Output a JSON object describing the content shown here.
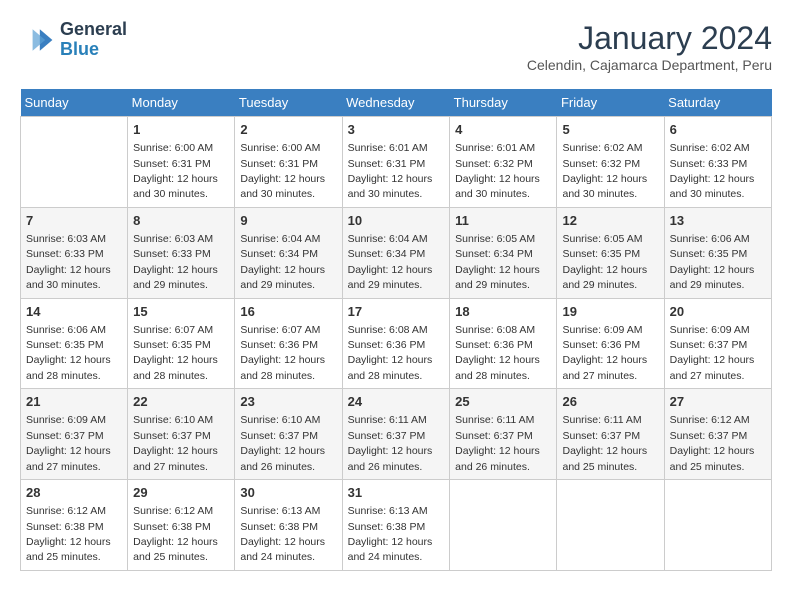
{
  "header": {
    "logo_general": "General",
    "logo_blue": "Blue",
    "month_title": "January 2024",
    "location": "Celendin, Cajamarca Department, Peru"
  },
  "days_of_week": [
    "Sunday",
    "Monday",
    "Tuesday",
    "Wednesday",
    "Thursday",
    "Friday",
    "Saturday"
  ],
  "weeks": [
    [
      {
        "num": "",
        "sunrise": "",
        "sunset": "",
        "daylight": ""
      },
      {
        "num": "1",
        "sunrise": "Sunrise: 6:00 AM",
        "sunset": "Sunset: 6:31 PM",
        "daylight": "Daylight: 12 hours and 30 minutes."
      },
      {
        "num": "2",
        "sunrise": "Sunrise: 6:00 AM",
        "sunset": "Sunset: 6:31 PM",
        "daylight": "Daylight: 12 hours and 30 minutes."
      },
      {
        "num": "3",
        "sunrise": "Sunrise: 6:01 AM",
        "sunset": "Sunset: 6:31 PM",
        "daylight": "Daylight: 12 hours and 30 minutes."
      },
      {
        "num": "4",
        "sunrise": "Sunrise: 6:01 AM",
        "sunset": "Sunset: 6:32 PM",
        "daylight": "Daylight: 12 hours and 30 minutes."
      },
      {
        "num": "5",
        "sunrise": "Sunrise: 6:02 AM",
        "sunset": "Sunset: 6:32 PM",
        "daylight": "Daylight: 12 hours and 30 minutes."
      },
      {
        "num": "6",
        "sunrise": "Sunrise: 6:02 AM",
        "sunset": "Sunset: 6:33 PM",
        "daylight": "Daylight: 12 hours and 30 minutes."
      }
    ],
    [
      {
        "num": "7",
        "sunrise": "Sunrise: 6:03 AM",
        "sunset": "Sunset: 6:33 PM",
        "daylight": "Daylight: 12 hours and 30 minutes."
      },
      {
        "num": "8",
        "sunrise": "Sunrise: 6:03 AM",
        "sunset": "Sunset: 6:33 PM",
        "daylight": "Daylight: 12 hours and 29 minutes."
      },
      {
        "num": "9",
        "sunrise": "Sunrise: 6:04 AM",
        "sunset": "Sunset: 6:34 PM",
        "daylight": "Daylight: 12 hours and 29 minutes."
      },
      {
        "num": "10",
        "sunrise": "Sunrise: 6:04 AM",
        "sunset": "Sunset: 6:34 PM",
        "daylight": "Daylight: 12 hours and 29 minutes."
      },
      {
        "num": "11",
        "sunrise": "Sunrise: 6:05 AM",
        "sunset": "Sunset: 6:34 PM",
        "daylight": "Daylight: 12 hours and 29 minutes."
      },
      {
        "num": "12",
        "sunrise": "Sunrise: 6:05 AM",
        "sunset": "Sunset: 6:35 PM",
        "daylight": "Daylight: 12 hours and 29 minutes."
      },
      {
        "num": "13",
        "sunrise": "Sunrise: 6:06 AM",
        "sunset": "Sunset: 6:35 PM",
        "daylight": "Daylight: 12 hours and 29 minutes."
      }
    ],
    [
      {
        "num": "14",
        "sunrise": "Sunrise: 6:06 AM",
        "sunset": "Sunset: 6:35 PM",
        "daylight": "Daylight: 12 hours and 28 minutes."
      },
      {
        "num": "15",
        "sunrise": "Sunrise: 6:07 AM",
        "sunset": "Sunset: 6:35 PM",
        "daylight": "Daylight: 12 hours and 28 minutes."
      },
      {
        "num": "16",
        "sunrise": "Sunrise: 6:07 AM",
        "sunset": "Sunset: 6:36 PM",
        "daylight": "Daylight: 12 hours and 28 minutes."
      },
      {
        "num": "17",
        "sunrise": "Sunrise: 6:08 AM",
        "sunset": "Sunset: 6:36 PM",
        "daylight": "Daylight: 12 hours and 28 minutes."
      },
      {
        "num": "18",
        "sunrise": "Sunrise: 6:08 AM",
        "sunset": "Sunset: 6:36 PM",
        "daylight": "Daylight: 12 hours and 28 minutes."
      },
      {
        "num": "19",
        "sunrise": "Sunrise: 6:09 AM",
        "sunset": "Sunset: 6:36 PM",
        "daylight": "Daylight: 12 hours and 27 minutes."
      },
      {
        "num": "20",
        "sunrise": "Sunrise: 6:09 AM",
        "sunset": "Sunset: 6:37 PM",
        "daylight": "Daylight: 12 hours and 27 minutes."
      }
    ],
    [
      {
        "num": "21",
        "sunrise": "Sunrise: 6:09 AM",
        "sunset": "Sunset: 6:37 PM",
        "daylight": "Daylight: 12 hours and 27 minutes."
      },
      {
        "num": "22",
        "sunrise": "Sunrise: 6:10 AM",
        "sunset": "Sunset: 6:37 PM",
        "daylight": "Daylight: 12 hours and 27 minutes."
      },
      {
        "num": "23",
        "sunrise": "Sunrise: 6:10 AM",
        "sunset": "Sunset: 6:37 PM",
        "daylight": "Daylight: 12 hours and 26 minutes."
      },
      {
        "num": "24",
        "sunrise": "Sunrise: 6:11 AM",
        "sunset": "Sunset: 6:37 PM",
        "daylight": "Daylight: 12 hours and 26 minutes."
      },
      {
        "num": "25",
        "sunrise": "Sunrise: 6:11 AM",
        "sunset": "Sunset: 6:37 PM",
        "daylight": "Daylight: 12 hours and 26 minutes."
      },
      {
        "num": "26",
        "sunrise": "Sunrise: 6:11 AM",
        "sunset": "Sunset: 6:37 PM",
        "daylight": "Daylight: 12 hours and 25 minutes."
      },
      {
        "num": "27",
        "sunrise": "Sunrise: 6:12 AM",
        "sunset": "Sunset: 6:37 PM",
        "daylight": "Daylight: 12 hours and 25 minutes."
      }
    ],
    [
      {
        "num": "28",
        "sunrise": "Sunrise: 6:12 AM",
        "sunset": "Sunset: 6:38 PM",
        "daylight": "Daylight: 12 hours and 25 minutes."
      },
      {
        "num": "29",
        "sunrise": "Sunrise: 6:12 AM",
        "sunset": "Sunset: 6:38 PM",
        "daylight": "Daylight: 12 hours and 25 minutes."
      },
      {
        "num": "30",
        "sunrise": "Sunrise: 6:13 AM",
        "sunset": "Sunset: 6:38 PM",
        "daylight": "Daylight: 12 hours and 24 minutes."
      },
      {
        "num": "31",
        "sunrise": "Sunrise: 6:13 AM",
        "sunset": "Sunset: 6:38 PM",
        "daylight": "Daylight: 12 hours and 24 minutes."
      },
      {
        "num": "",
        "sunrise": "",
        "sunset": "",
        "daylight": ""
      },
      {
        "num": "",
        "sunrise": "",
        "sunset": "",
        "daylight": ""
      },
      {
        "num": "",
        "sunrise": "",
        "sunset": "",
        "daylight": ""
      }
    ]
  ]
}
